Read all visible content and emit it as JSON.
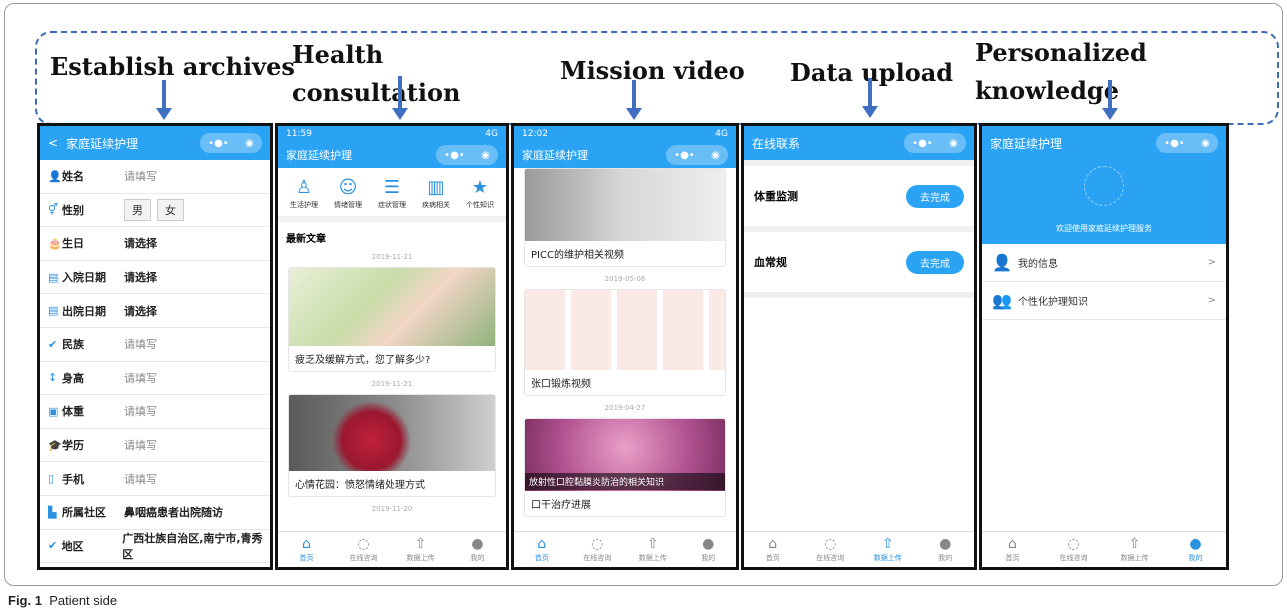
{
  "banner": {
    "labels": [
      "Establish archives",
      "Health\nconsultation",
      "Mission video",
      "Data upload",
      "Personalized\nknowledge"
    ]
  },
  "s1": {
    "title": "家庭延续护理",
    "back": "<",
    "fields": [
      {
        "icon": "👤",
        "label": "姓名",
        "value": "请填写",
        "dark": false
      },
      {
        "icon": "⚥",
        "label": "性别",
        "opt1": "男",
        "opt2": "女"
      },
      {
        "icon": "🎂",
        "label": "生日",
        "value": "请选择",
        "dark": true
      },
      {
        "icon": "▤",
        "label": "入院日期",
        "value": "请选择",
        "dark": true
      },
      {
        "icon": "▤",
        "label": "出院日期",
        "value": "请选择",
        "dark": true
      },
      {
        "icon": "✔",
        "label": "民族",
        "value": "请填写",
        "dark": false
      },
      {
        "icon": "↕",
        "label": "身高",
        "value": "请填写",
        "dark": false
      },
      {
        "icon": "▣",
        "label": "体重",
        "value": "请填写",
        "dark": false
      },
      {
        "icon": "🎓",
        "label": "学历",
        "value": "请填写",
        "dark": false
      },
      {
        "icon": "▯",
        "label": "手机",
        "value": "请填写",
        "dark": false
      },
      {
        "icon": "▙",
        "label": "所属社区",
        "value": "鼻咽癌患者出院随访",
        "dark": true
      },
      {
        "icon": "✔",
        "label": "地区",
        "value": "广西壮族自治区,南宁市,青秀区",
        "dark": true
      }
    ]
  },
  "s2": {
    "time": "11:59",
    "signal": "4G",
    "title": "家庭延续护理",
    "quick": [
      {
        "icon": "♙",
        "label": "生活护理"
      },
      {
        "icon": "☺",
        "label": "情绪管理"
      },
      {
        "icon": "☰",
        "label": "症状管理"
      },
      {
        "icon": "▥",
        "label": "疾病相关"
      },
      {
        "icon": "★",
        "label": "个性知识"
      }
    ],
    "section": "最新文章",
    "articles": [
      {
        "date": "2019-11-21",
        "caption": "疲乏及缓解方式，您了解多少?"
      },
      {
        "date": "2019-11-21",
        "caption": "心情花园：愤怒情绪处理方式"
      }
    ],
    "date3": "2019-11-20"
  },
  "s3": {
    "time": "12:02",
    "signal": "4G",
    "title": "家庭延续护理",
    "videos": [
      {
        "caption": "PICC的维护相关视频"
      },
      {
        "date": "2019-05-06",
        "caption": "张口锻炼视频"
      },
      {
        "date": "2019-04-27",
        "overlay": "放射性口腔黏膜炎防治的相关知识",
        "caption": "口干治疗进展"
      }
    ]
  },
  "s4": {
    "title": "在线联系",
    "tasks": [
      {
        "label": "体重监测",
        "button": "去完成"
      },
      {
        "label": "血常规",
        "button": "去完成"
      }
    ]
  },
  "s5": {
    "title": "家庭延续护理",
    "welcome": "欢迎使用家庭延续护理服务",
    "menu": [
      {
        "icon": "👤",
        "label": "我的信息"
      },
      {
        "icon": "👥",
        "label": "个性化护理知识"
      }
    ]
  },
  "tabs": [
    "首页",
    "在线咨询",
    "数据上传",
    "我的"
  ],
  "caption": {
    "fig": "Fig. 1",
    "text": "Patient side"
  },
  "colors": {
    "accent": "#2aa3f5",
    "banner": "#3f6fc0"
  }
}
